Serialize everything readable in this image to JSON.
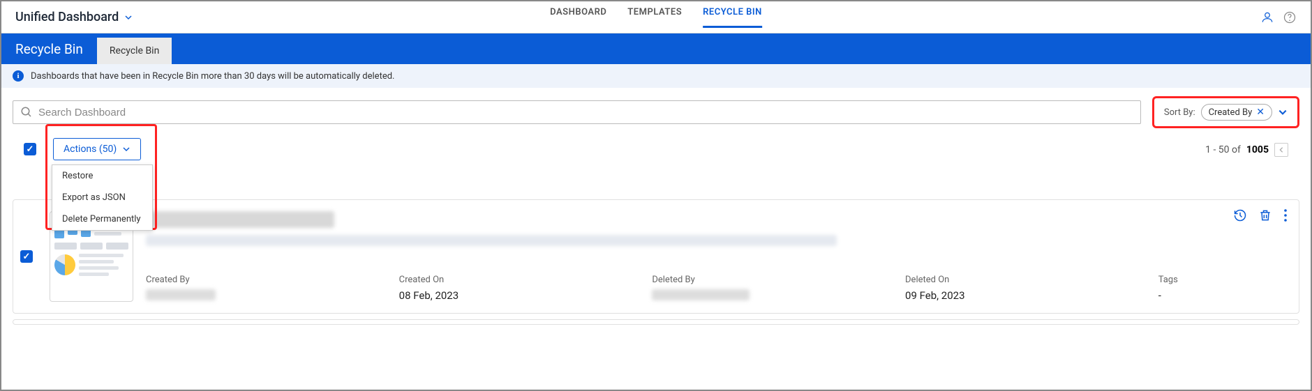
{
  "header": {
    "app_name": "Unified Dashboard",
    "tabs": [
      "DASHBOARD",
      "TEMPLATES",
      "RECYCLE BIN"
    ],
    "active_tab_index": 2
  },
  "blue_bar": {
    "title": "Recycle Bin",
    "tab_label": "Recycle Bin"
  },
  "info_banner": "Dashboards that have been in Recycle Bin more than 30 days will be automatically deleted.",
  "search": {
    "placeholder": "Search Dashboard"
  },
  "sort": {
    "label": "Sort By:",
    "chip": "Created By"
  },
  "actions": {
    "button_label": "Actions (50)",
    "menu": [
      "Restore",
      "Export as JSON",
      "Delete Permanently"
    ]
  },
  "pagination": {
    "range_prefix": "1 - 50 of ",
    "total": "1005"
  },
  "card": {
    "meta": {
      "created_by_label": "Created By",
      "created_on_label": "Created On",
      "created_on_value": "08 Feb, 2023",
      "deleted_by_label": "Deleted By",
      "deleted_on_label": "Deleted On",
      "deleted_on_value": "09 Feb, 2023",
      "tags_label": "Tags",
      "tags_value": "-"
    }
  }
}
